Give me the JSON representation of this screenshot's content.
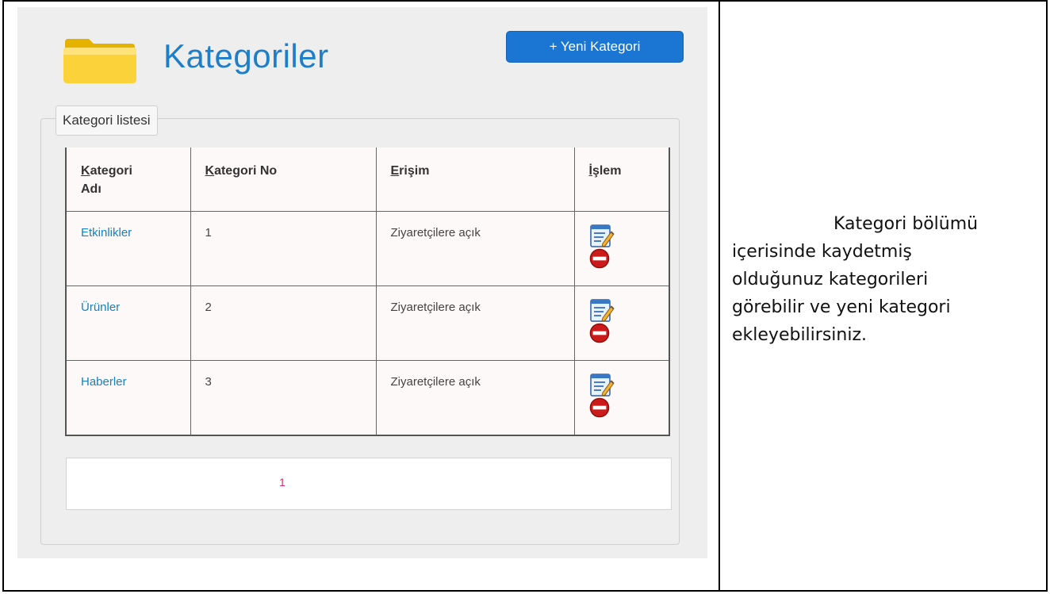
{
  "page": {
    "title": "Kategoriler",
    "new_button": "+ Yeni Kategori",
    "folder_icon": "folder-icon"
  },
  "list": {
    "legend": "Kategori listesi",
    "columns": [
      {
        "first": "K",
        "rest": "ategori",
        "line2": "Adı"
      },
      {
        "first": "K",
        "rest": "ategori No",
        "line2": ""
      },
      {
        "first": "E",
        "rest": "rişim",
        "line2": ""
      },
      {
        "first": "İ",
        "rest": "şlem",
        "line2": ""
      }
    ],
    "rows": [
      {
        "name": "Etkinlikler",
        "no": "1",
        "access": "Ziyaretçilere açık"
      },
      {
        "name": "Ürünler",
        "no": "2",
        "access": "Ziyaretçilere açık"
      },
      {
        "name": "Haberler",
        "no": "3",
        "access": "Ziyaretçilere açık"
      }
    ],
    "action_icons": [
      "edit-icon",
      "delete-icon"
    ]
  },
  "pagination": {
    "pages": [
      "1"
    ],
    "current": "1"
  },
  "description": {
    "lines": [
      "Kategori bölümü",
      "içerisinde kaydetmiş",
      "olduğunuz kategorileri",
      "görebilir ve yeni kategori",
      "ekleyebilirsiniz."
    ]
  },
  "colors": {
    "title": "#1e7ec8",
    "button": "#1a76d2",
    "link": "#1a80c0",
    "page_number": "#d92a68",
    "panel_bg": "#eeeeee"
  }
}
